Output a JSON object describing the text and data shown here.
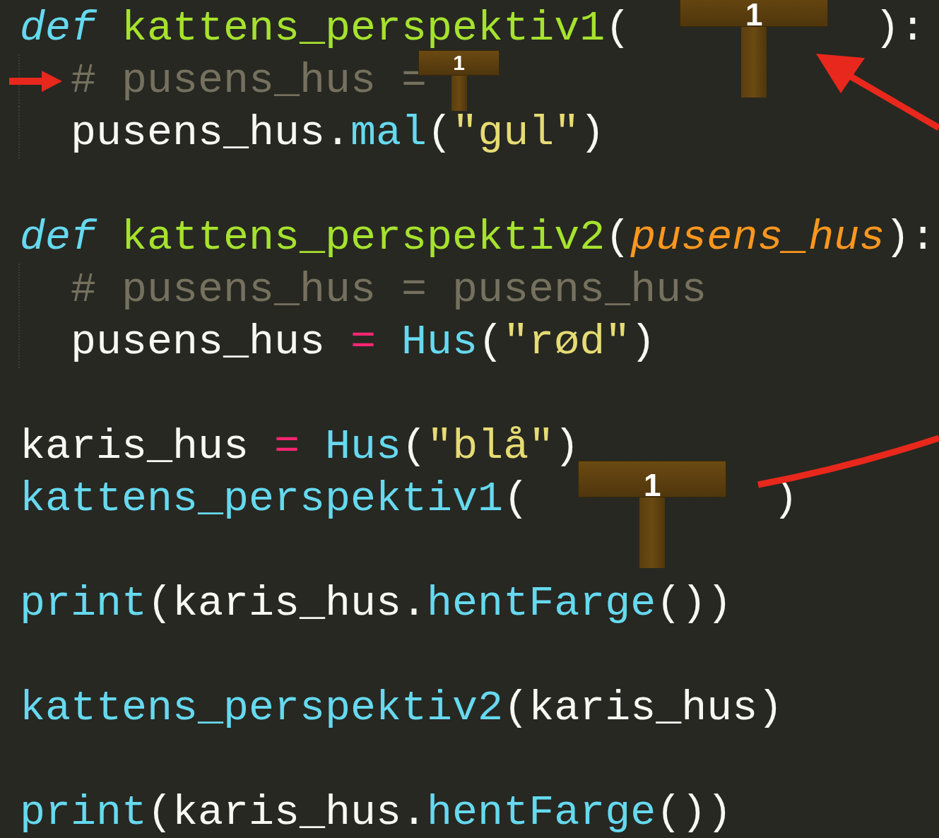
{
  "lines": [
    {
      "kind": "code",
      "indented": false,
      "marked": false,
      "tokens": [
        {
          "kind": "keyword",
          "text": "def"
        },
        {
          "kind": "function",
          "text": " kattens_perspektiv1"
        },
        {
          "kind": "plain",
          "text": "("
        },
        {
          "kind": "slot",
          "label": "1"
        },
        {
          "kind": "plain",
          "text": "):"
        }
      ]
    },
    {
      "kind": "code",
      "indented": true,
      "marked": true,
      "tokens": [
        {
          "kind": "comment",
          "text": "# pusens_hus ="
        },
        {
          "kind": "inline_slot",
          "label": "1"
        }
      ]
    },
    {
      "kind": "code",
      "indented": true,
      "marked": false,
      "tokens": [
        {
          "kind": "plain",
          "text": "pusens_hus."
        },
        {
          "kind": "call",
          "text": "mal"
        },
        {
          "kind": "plain",
          "text": "("
        },
        {
          "kind": "string",
          "text": "\"gul\""
        },
        {
          "kind": "plain",
          "text": ")"
        }
      ]
    },
    {
      "kind": "blank"
    },
    {
      "kind": "code",
      "indented": false,
      "marked": false,
      "tokens": [
        {
          "kind": "keyword",
          "text": "def"
        },
        {
          "kind": "function",
          "text": " kattens_perspektiv2"
        },
        {
          "kind": "plain",
          "text": "("
        },
        {
          "kind": "param",
          "text": "pusens_hus"
        },
        {
          "kind": "plain",
          "text": "):"
        }
      ]
    },
    {
      "kind": "code",
      "indented": true,
      "marked": false,
      "tokens": [
        {
          "kind": "comment",
          "text": "# pusens_hus = pusens_hus"
        }
      ]
    },
    {
      "kind": "code",
      "indented": true,
      "marked": false,
      "tokens": [
        {
          "kind": "plain",
          "text": "pusens_hus "
        },
        {
          "kind": "operator",
          "text": "="
        },
        {
          "kind": "call",
          "text": " Hus"
        },
        {
          "kind": "plain",
          "text": "("
        },
        {
          "kind": "string",
          "text": "\"rød\""
        },
        {
          "kind": "plain",
          "text": ")"
        }
      ]
    },
    {
      "kind": "blank"
    },
    {
      "kind": "code",
      "indented": false,
      "marked": false,
      "tokens": [
        {
          "kind": "plain",
          "text": "karis_hus "
        },
        {
          "kind": "operator",
          "text": "="
        },
        {
          "kind": "call",
          "text": " Hus"
        },
        {
          "kind": "plain",
          "text": "("
        },
        {
          "kind": "string",
          "text": "\"blå\""
        },
        {
          "kind": "plain",
          "text": ")"
        }
      ]
    },
    {
      "kind": "code",
      "indented": false,
      "marked": false,
      "tokens": [
        {
          "kind": "call",
          "text": "kattens_perspektiv1"
        },
        {
          "kind": "plain",
          "text": "("
        },
        {
          "kind": "slot",
          "label": "1"
        },
        {
          "kind": "plain",
          "text": ")"
        }
      ]
    },
    {
      "kind": "blank"
    },
    {
      "kind": "code",
      "indented": false,
      "marked": false,
      "tokens": [
        {
          "kind": "call",
          "text": "print"
        },
        {
          "kind": "plain",
          "text": "(karis_hus."
        },
        {
          "kind": "call",
          "text": "hentFarge"
        },
        {
          "kind": "plain",
          "text": "())"
        }
      ]
    },
    {
      "kind": "blank"
    },
    {
      "kind": "code",
      "indented": false,
      "marked": false,
      "tokens": [
        {
          "kind": "call",
          "text": "kattens_perspektiv2"
        },
        {
          "kind": "plain",
          "text": "(karis_hus)"
        }
      ]
    },
    {
      "kind": "blank"
    },
    {
      "kind": "code",
      "indented": false,
      "marked": false,
      "tokens": [
        {
          "kind": "call",
          "text": "print"
        },
        {
          "kind": "plain",
          "text": "(karis_hus."
        },
        {
          "kind": "call",
          "text": "hentFarge"
        },
        {
          "kind": "plain",
          "text": "())"
        }
      ]
    }
  ]
}
